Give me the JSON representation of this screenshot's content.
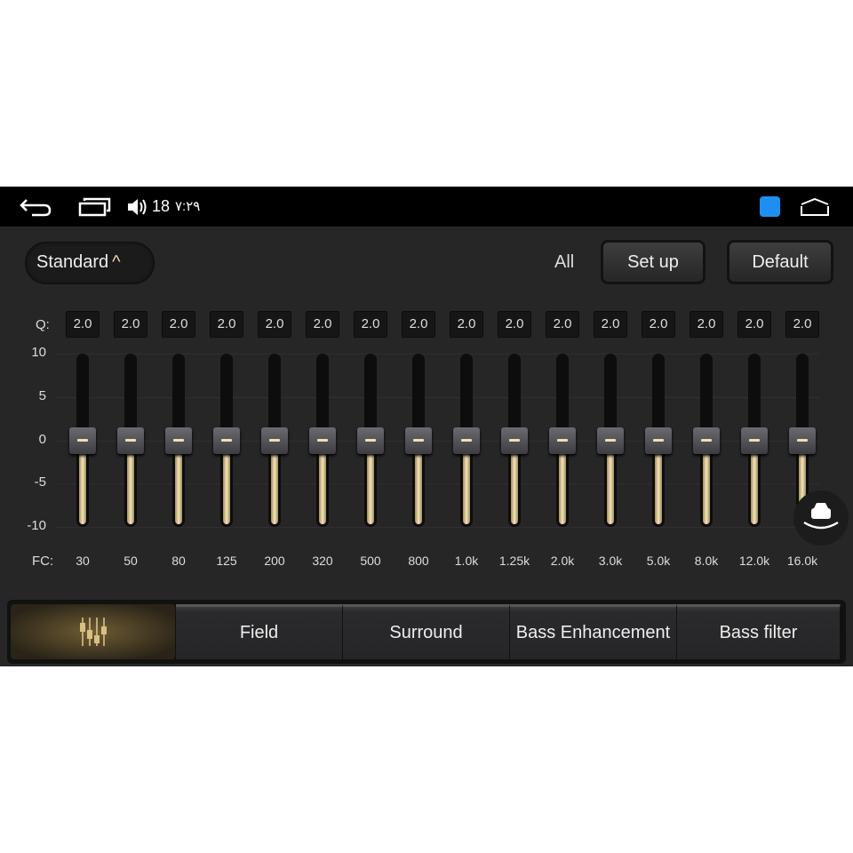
{
  "status_bar": {
    "volume": "18",
    "time": "۷:۲۹",
    "icons": [
      "back-icon",
      "recent-apps-icon",
      "volume-icon",
      "app-notification-icon",
      "home-icon"
    ]
  },
  "header": {
    "preset": "Standard",
    "all_label": "All",
    "setup_label": "Set up",
    "default_label": "Default"
  },
  "eq": {
    "q_label": "Q:",
    "fc_label": "FC:",
    "y_ticks": [
      "10",
      "5",
      "0",
      "-5",
      "-10"
    ],
    "y_range": [
      -10,
      10
    ],
    "bands": [
      {
        "fc": "30",
        "q": "2.0",
        "gain": 0
      },
      {
        "fc": "50",
        "q": "2.0",
        "gain": 0
      },
      {
        "fc": "80",
        "q": "2.0",
        "gain": 0
      },
      {
        "fc": "125",
        "q": "2.0",
        "gain": 0
      },
      {
        "fc": "200",
        "q": "2.0",
        "gain": 0
      },
      {
        "fc": "320",
        "q": "2.0",
        "gain": 0
      },
      {
        "fc": "500",
        "q": "2.0",
        "gain": 0
      },
      {
        "fc": "800",
        "q": "2.0",
        "gain": 0
      },
      {
        "fc": "1.0k",
        "q": "2.0",
        "gain": 0
      },
      {
        "fc": "1.25k",
        "q": "2.0",
        "gain": 0
      },
      {
        "fc": "2.0k",
        "q": "2.0",
        "gain": 0
      },
      {
        "fc": "3.0k",
        "q": "2.0",
        "gain": 0
      },
      {
        "fc": "5.0k",
        "q": "2.0",
        "gain": 0
      },
      {
        "fc": "8.0k",
        "q": "2.0",
        "gain": 0
      },
      {
        "fc": "12.0k",
        "q": "2.0",
        "gain": 0
      },
      {
        "fc": "16.0k",
        "q": "2.0",
        "gain": 0
      }
    ]
  },
  "tabs": [
    "Field",
    "Surround",
    "Bass Enhancement",
    "Bass filter"
  ],
  "colors": {
    "accent": "#f3e4b8",
    "background": "#262626"
  }
}
